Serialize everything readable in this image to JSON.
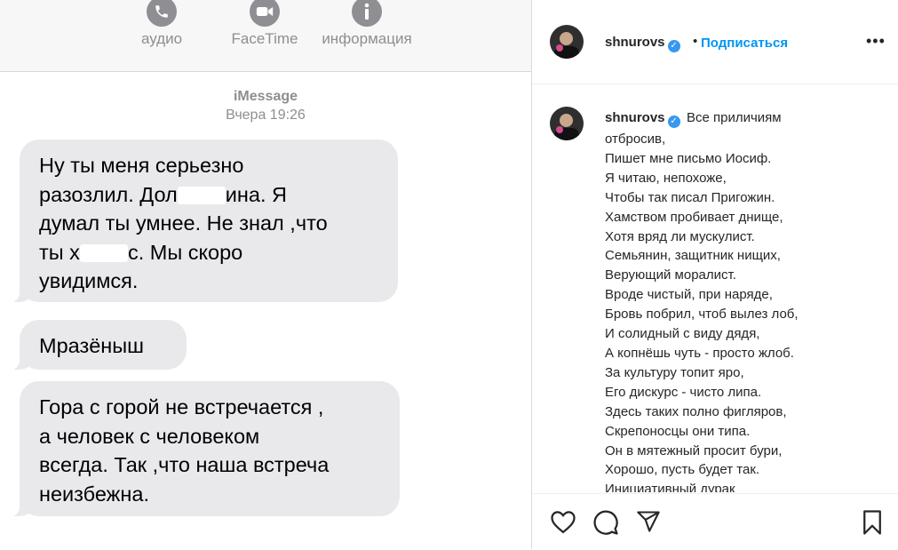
{
  "imessage": {
    "header_actions": [
      {
        "label": "аудио",
        "icon": "phone-icon"
      },
      {
        "label": "FaceTime",
        "icon": "video-camera-icon"
      },
      {
        "label": "информация",
        "icon": "info-icon"
      }
    ],
    "service": "iMessage",
    "timestamp": "Вчера 19:26",
    "messages": [
      {
        "lines": [
          "Ну ты меня серьезно",
          "разозлил. Дол",
          "ина. Я",
          "думал ты умнее. Не знал ,что",
          "ты х",
          "с. Мы скоро",
          "увидимся."
        ]
      },
      {
        "lines": [
          "Мразёныш"
        ]
      },
      {
        "lines": [
          "Гора с горой не встречается ,",
          "а человек с человеком",
          "всегда. Так ,что наша встреча",
          "неизбежна."
        ]
      }
    ]
  },
  "instagram": {
    "username": "shnurovs",
    "separator": "•",
    "follow_label": "Подписаться",
    "more_icon": "ellipsis-icon",
    "caption_first": "Все приличиям",
    "poem_lines": [
      "отбросив,",
      "Пишет мне письмо Иосиф.",
      "Я читаю, непохоже,",
      "Чтобы так писал Пригожин.",
      "Хамством пробивает днище,",
      "Хотя вряд ли мускулист.",
      "Семьянин, защитник нищих,",
      "Верующий моралист.",
      "Вроде чистый, при наряде,",
      "Бровь побрил, чтоб вылез лоб,",
      "И солидный с виду дядя,",
      "А копнёшь чуть - просто жлоб.",
      "За культуру топит яро,",
      "Его дискурс - чисто липа.",
      "Здесь таких полно фигляров,",
      "Скрепоносцы они типа.",
      "Он в мятежный просит бури,",
      "Хорошо, пусть будет так.",
      "Инициативный дурак"
    ],
    "actions": [
      "heart-icon",
      "comment-icon",
      "share-icon",
      "bookmark-icon"
    ],
    "accent": "#0095f6"
  }
}
